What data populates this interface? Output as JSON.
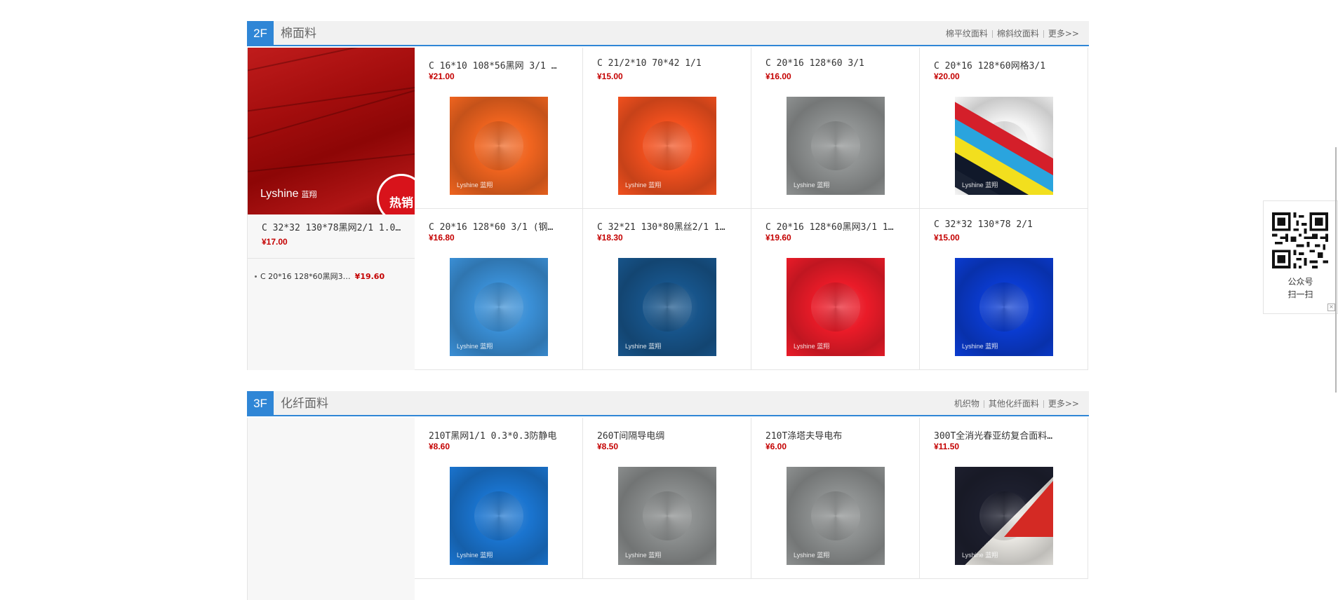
{
  "floors": [
    {
      "badge": "2F",
      "title": "棉面料",
      "links": [
        "棉平纹面料",
        "棉斜纹面料",
        "更多>>"
      ],
      "hero": {
        "brand": "Lyshine",
        "brand_cn": "蓝翔",
        "tag": "热销",
        "name": "C 32*32 130*78黑网2/1 1.0…",
        "price": "¥17.00"
      },
      "mini": {
        "name": "C 20*16 128*60黑网3…",
        "price": "¥19.60"
      },
      "products": [
        {
          "name": "C 16*10 108*56黑网 3/1 …",
          "price": "¥21.00",
          "color": "#f0641f",
          "wm": "Lyshine 蓝翔"
        },
        {
          "name": "C 21/2*10 70*42 1/1",
          "price": "¥15.00",
          "color": "#f2501e",
          "wm": "Lyshine 蓝翔"
        },
        {
          "name": "C 20*16 128*60 3/1",
          "price": "¥16.00",
          "color": "#8e9191",
          "wm": "Lyshine 蓝翔"
        },
        {
          "name": "C 20*16 128*60网格3/1",
          "price": "¥20.00",
          "color": "multi",
          "wm": "Lyshine 蓝翔"
        },
        {
          "name": "C 20*16 128*60 3/1 (钢…",
          "price": "¥16.80",
          "color": "#3a8fd6",
          "wm": "Lyshine 蓝翔"
        },
        {
          "name": "C 32*21 130*80黑丝2/1 1…",
          "price": "¥18.30",
          "color": "#17548a",
          "wm": "Lyshine 蓝翔"
        },
        {
          "name": "C 20*16 128*60黑网3/1 1…",
          "price": "¥19.60",
          "color": "#ea1b28",
          "wm": "Lyshine 蓝翔"
        },
        {
          "name": "C 32*32 130*78 2/1",
          "price": "¥15.00",
          "color": "#0a3bd0",
          "wm": "Lyshine 蓝翔"
        }
      ]
    },
    {
      "badge": "3F",
      "title": "化纤面料",
      "links": [
        "机织物",
        "其他化纤面料",
        "更多>>"
      ],
      "products": [
        {
          "name": "210T黑网1/1 0.3*0.3防静电",
          "price": "¥8.60",
          "color": "#1a74cf",
          "wm": "Lyshine 蓝翔"
        },
        {
          "name": "260T间隔导电绸",
          "price": "¥8.50",
          "color": "#8a8d8d",
          "wm": "Lyshine 蓝翔"
        },
        {
          "name": "210T涤塔夫导电布",
          "price": "¥6.00",
          "color": "#8d9090",
          "wm": "Lyshine 蓝翔"
        },
        {
          "name": "300T全消光春亚纺复合面料…",
          "price": "¥11.50",
          "color": "multi2",
          "wm": "Lyshine 蓝翔"
        }
      ]
    }
  ],
  "qr": {
    "line1": "公众号",
    "line2": "扫一扫",
    "close": "×"
  },
  "colors": {
    "accent": "#2f86d6",
    "price": "#c40000"
  }
}
